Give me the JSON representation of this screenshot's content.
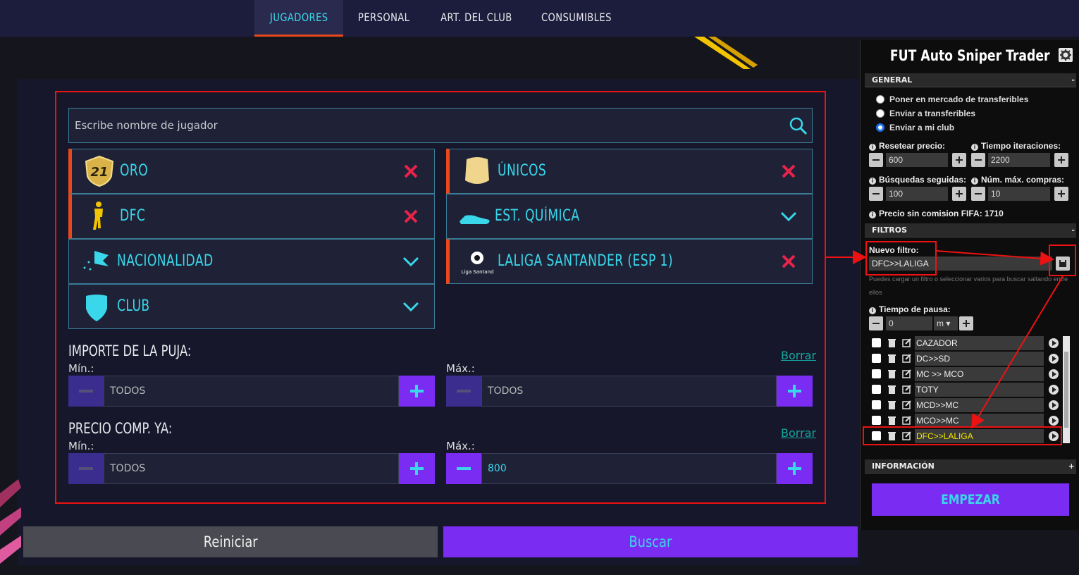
{
  "nav": {
    "tabs": [
      {
        "label": "JUGADORES",
        "active": true
      },
      {
        "label": "PERSONAL",
        "active": false
      },
      {
        "label": "ART. DEL CLUB",
        "active": false
      },
      {
        "label": "CONSUMIBLES",
        "active": false
      }
    ]
  },
  "search": {
    "placeholder": "Escribe nombre de jugador"
  },
  "filters": {
    "quality": {
      "label": "ORO",
      "badge": "21"
    },
    "rarity": {
      "label": "ÚNICOS"
    },
    "position": {
      "label": "DFC"
    },
    "chemistry": {
      "label": "EST. QUÍMICA"
    },
    "nationality": {
      "label": "NACIONALIDAD"
    },
    "league": {
      "label": "LALIGA SANTANDER (ESP 1)",
      "logo_text": "LaLiga Santander"
    },
    "club": {
      "label": "CLUB"
    }
  },
  "bid": {
    "title": "IMPORTE DE LA PUJA:",
    "clear": "Borrar",
    "min_label": "Mín.:",
    "max_label": "Máx.:",
    "min_value": "TODOS",
    "max_value": "TODOS"
  },
  "buy_now": {
    "title": "PRECIO COMP. YA:",
    "clear": "Borrar",
    "min_label": "Mín.:",
    "max_label": "Máx.:",
    "min_value": "TODOS",
    "max_value": "800"
  },
  "actions": {
    "reset": "Reiniciar",
    "search": "Buscar"
  },
  "panel": {
    "title": "FUT Auto Sniper Trader",
    "general": {
      "header": "GENERAL",
      "toggle": "-",
      "options": [
        {
          "label": "Poner en mercado de transferibles",
          "selected": false
        },
        {
          "label": "Enviar a transferibles",
          "selected": false
        },
        {
          "label": "Enviar a mi club",
          "selected": true
        }
      ],
      "reset_price": {
        "label": "Resetear precio:",
        "value": "600"
      },
      "iter_time": {
        "label": "Tiempo iteraciones:",
        "value": "2200"
      },
      "searches": {
        "label": "Búsquedas seguidas:",
        "value": "100"
      },
      "max_buys": {
        "label": "Núm. máx. compras:",
        "value": "10"
      },
      "no_commission": {
        "label": "Precio sin comision FIFA:",
        "value": "1710"
      }
    },
    "filters": {
      "header": "FILTROS",
      "toggle": "-",
      "new_filter_label": "Nuevo filtro:",
      "new_filter_value": "DFC>>LALIGA",
      "hint": "Puedes cargar un filtro o seleccionar varios para buscar saltando entre ellos",
      "pause_label": "Tiempo de pausa:",
      "pause_value": "0",
      "pause_unit": "m",
      "items": [
        {
          "name": "CAZADOR",
          "highlight": false
        },
        {
          "name": "DC>>SD",
          "highlight": false
        },
        {
          "name": "MC >> MCO",
          "highlight": false
        },
        {
          "name": "TOTY",
          "highlight": false
        },
        {
          "name": "MCD>>MC",
          "highlight": false
        },
        {
          "name": "MCO>>MC",
          "highlight": false
        },
        {
          "name": "DFC>>LALIGA",
          "highlight": true
        }
      ]
    },
    "info": {
      "header": "INFORMACIÓN",
      "toggle": "+"
    },
    "start": "EMPEZAR"
  },
  "colors": {
    "accent": "#3ad6ea",
    "primary": "#7a2cf2",
    "orange": "#e8481c",
    "annotation": "#ee1111"
  }
}
